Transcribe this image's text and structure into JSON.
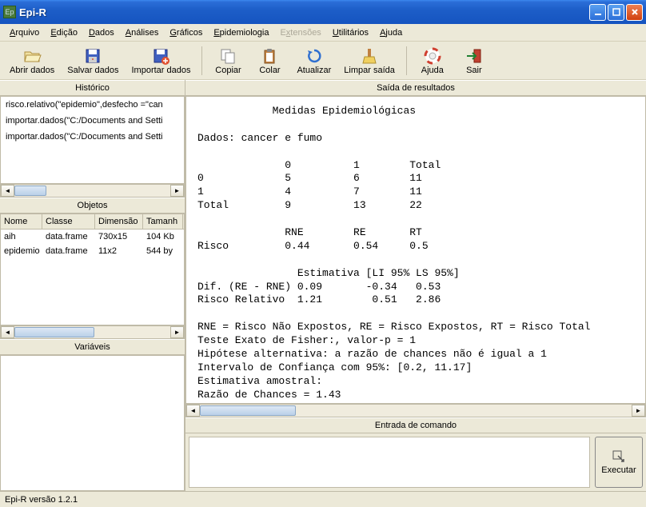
{
  "window": {
    "title": "Epi-R"
  },
  "menu": {
    "arquivo": "Arquivo",
    "edicao": "Edição",
    "dados": "Dados",
    "analises": "Análises",
    "graficos": "Gráficos",
    "epidemiologia": "Epidemiologia",
    "extensoes": "Extensões",
    "utilitarios": "Utilitários",
    "ajuda": "Ajuda"
  },
  "toolbar": {
    "abrir": "Abrir dados",
    "salvar": "Salvar dados",
    "importar": "Importar dados",
    "copiar": "Copiar",
    "colar": "Colar",
    "atualizar": "Atualizar",
    "limpar": "Limpar saída",
    "ajuda": "Ajuda",
    "sair": "Sair"
  },
  "panes": {
    "historico": "Histórico",
    "objetos": "Objetos",
    "variaveis": "Variáveis",
    "saida": "Saída de resultados",
    "entrada": "Entrada de comando"
  },
  "history": [
    "risco.relativo(\"epidemio\",desfecho =\"can",
    "importar.dados(\"C:/Documents and Setti",
    "importar.dados(\"C:/Documents and Setti"
  ],
  "objects": {
    "headers": {
      "nome": "Nome",
      "classe": "Classe",
      "dimensao": "Dimensão",
      "tamanho": "Tamanh"
    },
    "rows": [
      {
        "nome": "aih",
        "classe": "data.frame",
        "dimensao": "730x15",
        "tamanho": "104 Kb"
      },
      {
        "nome": "epidemio",
        "classe": "data.frame",
        "dimensao": "11x2",
        "tamanho": "544 by"
      }
    ]
  },
  "output": "            Medidas Epidemiológicas\n\nDados: cancer e fumo\n\n              0          1        Total\n0             5          6        11\n1             4          7        11\nTotal         9          13       22\n\n              RNE        RE       RT\nRisco         0.44       0.54     0.5\n\n                Estimativa [LI 95% LS 95%]\nDif. (RE - RNE) 0.09       -0.34   0.53\nRisco Relativo  1.21        0.51   2.86\n\nRNE = Risco Não Expostos, RE = Risco Expostos, RT = Risco Total\nTeste Exato de Fisher:, valor-p = 1\nHipótese alternativa: a razão de chances não é igual a 1\nIntervalo de Confiança com 95%: [0.2, 11.17]\nEstimativa amostral:\nRazão de Chances = 1.43",
  "exec_btn": "Executar",
  "status": "Epi-R versão 1.2.1"
}
